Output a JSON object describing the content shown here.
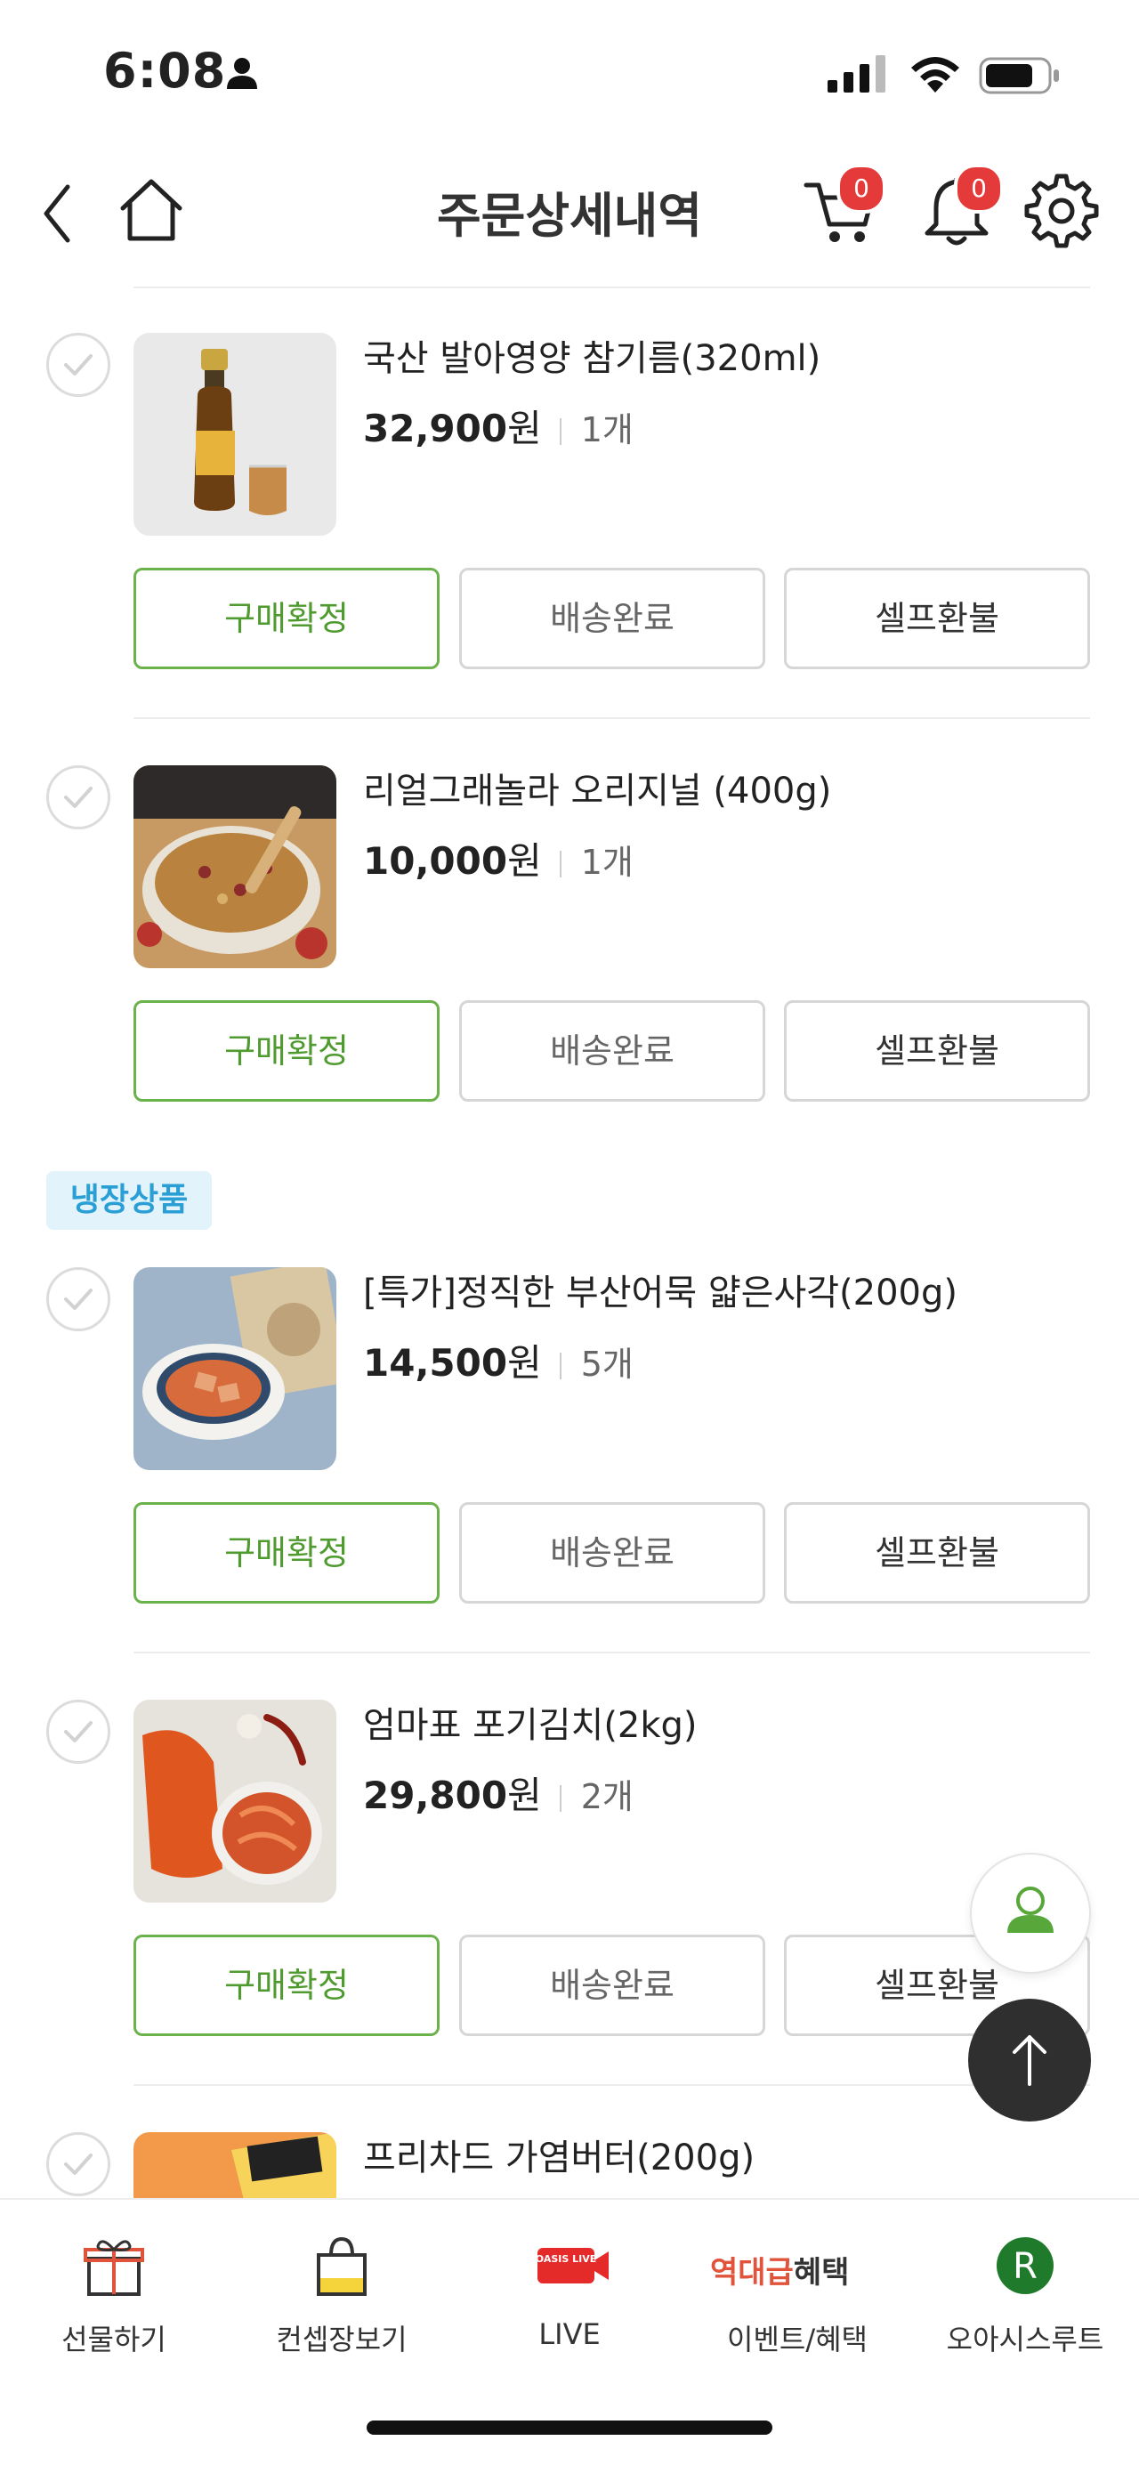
{
  "status_bar": {
    "time": "6:08"
  },
  "header": {
    "title": "주문상세내역",
    "cart_count": "0",
    "notification_count": "0"
  },
  "section": {
    "chilled_label": "냉장상품"
  },
  "actions": {
    "confirm": "구매확정",
    "delivered": "배송완료",
    "refund": "셀프환불"
  },
  "items": [
    {
      "name": "국산 발아영양 참기름(320ml)",
      "price": "32,900",
      "currency": "원",
      "qty": "1개"
    },
    {
      "name": "리얼그래놀라 오리지널 (400g)",
      "price": "10,000",
      "currency": "원",
      "qty": "1개"
    },
    {
      "name": "[특가]정직한 부산어묵 얇은사각(200g)",
      "price": "14,500",
      "currency": "원",
      "qty": "5개"
    },
    {
      "name": "엄마표 포기김치(2kg)",
      "price": "29,800",
      "currency": "원",
      "qty": "2개"
    },
    {
      "name": "프리차드 가염버터(200g)"
    }
  ],
  "bottom_nav": [
    {
      "label": "선물하기",
      "icon": "gift-icon"
    },
    {
      "label": "컨셉장보기",
      "icon": "shopping-bag-icon"
    },
    {
      "label": "LIVE",
      "icon": "oasis-live-icon",
      "icon_text": "OASIS LIVE"
    },
    {
      "label": "이벤트/혜택",
      "icon": "event-benefit-icon",
      "icon_text_red": "역대급",
      "icon_text_dark": "혜택"
    },
    {
      "label": "오아시스루트",
      "icon": "oasis-root-icon",
      "icon_text": "R"
    }
  ],
  "colors": {
    "green": "#4f9b2f",
    "badge_red": "#e53a3a",
    "chilled_blue": "#2a9fd6"
  }
}
